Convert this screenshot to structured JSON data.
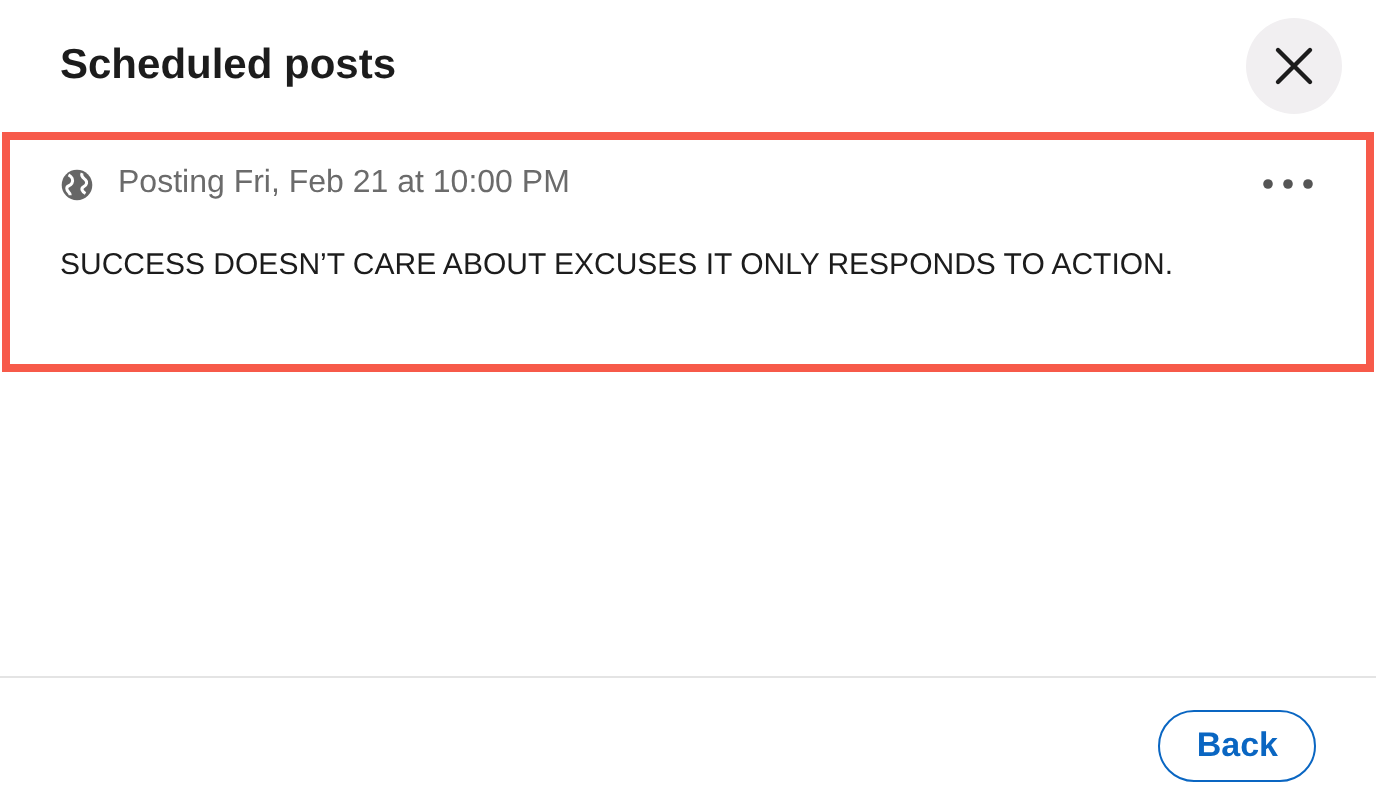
{
  "dialog": {
    "title": "Scheduled posts"
  },
  "posts": [
    {
      "schedule": "Posting Fri, Feb 21 at 10:00 PM",
      "text": "SUCCESS DOESN’T CARE ABOUT EXCUSES IT ONLY RESPONDS TO ACTION.",
      "highlighted": true
    }
  ],
  "footer": {
    "buttons": [
      "Back"
    ]
  }
}
